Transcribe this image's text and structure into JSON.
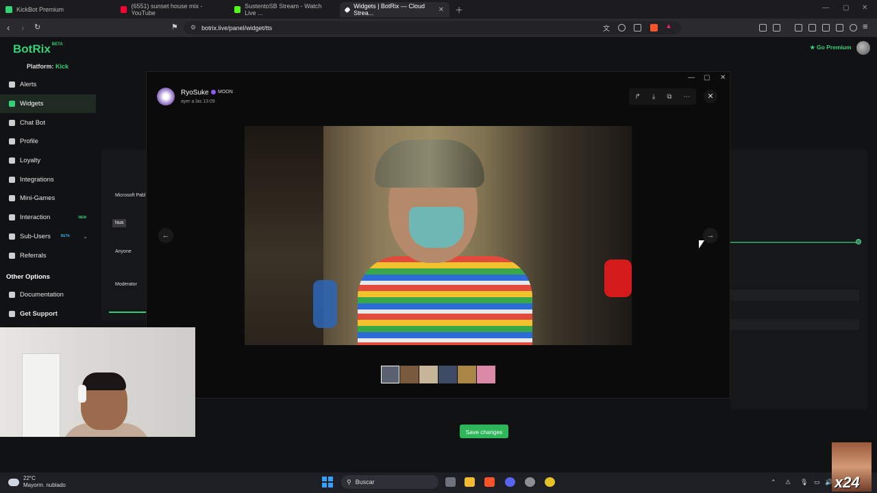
{
  "browser": {
    "tabs": [
      {
        "title": "KickBot Premium",
        "color": "#33d17a"
      },
      {
        "title": "(6551) sunset house mix - YouTube",
        "color": "#ff0033"
      },
      {
        "title": "SustentoSB Stream - Watch Live ...",
        "color": "#53fc18"
      },
      {
        "title": "Widgets | BotRix — Cloud Strea...",
        "color": "#ffffff"
      }
    ],
    "url": "botrix.live/panel/widget/tts"
  },
  "app": {
    "brand": "BotRix",
    "brand_tag": "BETA",
    "platform_label": "Platform:",
    "platform_value": "Kick",
    "go_premium": "Go Premium",
    "sidebar": [
      {
        "label": "Alerts",
        "icon": "bell-icon"
      },
      {
        "label": "Widgets",
        "icon": "widgets-icon",
        "active": true
      },
      {
        "label": "Chat Bot",
        "icon": "bot-icon"
      },
      {
        "label": "Profile",
        "icon": "profile-icon"
      },
      {
        "label": "Loyalty",
        "icon": "trophy-icon"
      },
      {
        "label": "Integrations",
        "icon": "link-icon"
      },
      {
        "label": "Mini-Games",
        "icon": "gamepad-icon"
      },
      {
        "label": "Interaction",
        "icon": "interaction-icon",
        "badge": "NEW"
      },
      {
        "label": "Sub-Users",
        "icon": "users-icon",
        "badge": "BETA"
      },
      {
        "label": "Referrals",
        "icon": "referrals-icon"
      }
    ],
    "other_options_title": "Other Options",
    "other_options": [
      {
        "label": "Documentation",
        "icon": "doc-icon"
      },
      {
        "label": "Get Support",
        "icon": "help-icon"
      }
    ],
    "left_panel": {
      "voice": "Microsoft Pabl",
      "input_value": "!sus",
      "who_can_use": "Anyone",
      "bypass": "Moderator"
    },
    "save_label": "Save changes"
  },
  "viewer": {
    "user_name": "RyoSuke",
    "user_badge": "MOON",
    "timestamp": "ayer a las 13:09",
    "thumb_colors": [
      "#5a6272",
      "#7a5a3c",
      "#c7b59a",
      "#3e4c66",
      "#a88646",
      "#d98aa6"
    ]
  },
  "taskbar": {
    "temperature": "22°C",
    "weather": "Mayorm. nublado",
    "search": "Buscar"
  },
  "overlay": {
    "meme_text": "x24"
  }
}
